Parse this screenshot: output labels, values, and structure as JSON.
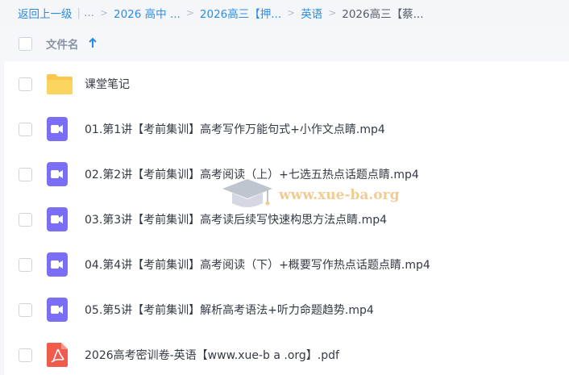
{
  "breadcrumb": {
    "back": "返回上一级",
    "ellipsis": "...",
    "crumbs": [
      "2026 高中 ...",
      "2026高三【押...",
      "英语"
    ],
    "current": "2026高三【蔡..."
  },
  "header": {
    "column_name": "文件名"
  },
  "files": [
    {
      "name": "课堂笔记",
      "type": "folder"
    },
    {
      "name": "01.第1讲【考前集训】高考写作万能句式+小作文点睛.mp4",
      "type": "video"
    },
    {
      "name": "02.第2讲【考前集训】高考阅读（上）+七选五热点话题点睛.mp4",
      "type": "video"
    },
    {
      "name": "03.第3讲【考前集训】高考读后续写快速构思方法点睛.mp4",
      "type": "video"
    },
    {
      "name": "04.第4讲【考前集训】高考阅读（下）+概要写作热点话题点睛.mp4",
      "type": "video"
    },
    {
      "name": "05.第5讲【考前集训】解析高考语法+听力命题趋势.mp4",
      "type": "video"
    },
    {
      "name": "2026高考密训卷-英语【www.xue-b a .org】.pdf",
      "type": "pdf"
    }
  ],
  "watermark": {
    "text": "www.xue-ba.org",
    "icon": "graduation-cap-icon"
  },
  "colors": {
    "link": "#2b8ce6",
    "folder": "#f9c74f",
    "video": "#7b6ef6",
    "pdf": "#f25a4b"
  }
}
